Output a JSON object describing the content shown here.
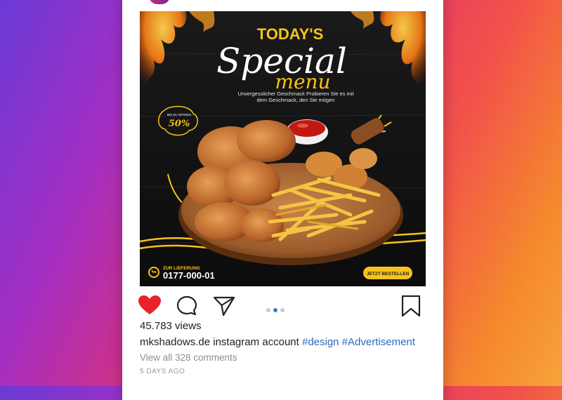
{
  "post": {
    "ad": {
      "headline": "TODAY'S",
      "script_title": "Special",
      "script_subtitle": "menu",
      "tagline_line1": "Unvergesslicher Geschmack Probieren Sie es mit",
      "tagline_line2": "dem Geschmack, den Sie mögen",
      "discount_label": "BIS ZU SPAREN",
      "discount_value": "50%",
      "delivery_label": "ZUR LIEFERUNG",
      "phone": "0177-000-01",
      "cta": "JETZT BESTELLEN"
    },
    "views": "45.783 views",
    "caption_user": "mkshadows.de",
    "caption_text": "instagram account",
    "hashtag_1": "#design",
    "hashtag_2": "#Advertisement",
    "comments_link": "View all 328 comments",
    "timestamp": "5 DAYS AGO",
    "carousel": {
      "count": 3,
      "active_index": 2
    }
  },
  "colors": {
    "like_active": "#e8222b",
    "accent_yellow": "#f7c21a",
    "hashtag": "#2a6bb8",
    "carousel_active": "#2e7fd6"
  },
  "icons": [
    "heart-icon",
    "comment-icon",
    "share-icon",
    "bookmark-icon"
  ]
}
